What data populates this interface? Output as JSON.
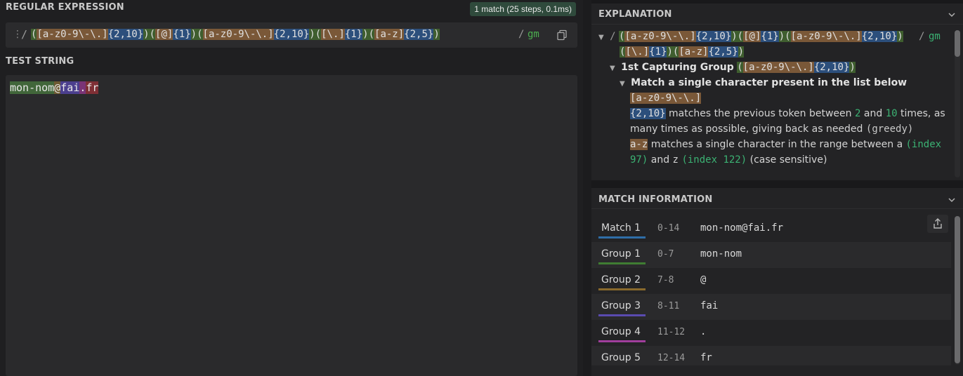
{
  "regex_section": {
    "title": "REGULAR EXPRESSION",
    "match_badge": "1 match (25 steps, 0.1ms)",
    "delimiter": "/",
    "tokens": {
      "t1": "(",
      "t2": "[a-z0-9\\-\\.]",
      "t3": "{2,10}",
      "t4": ")",
      "t5": "(",
      "t6": "[@]",
      "t7": "{1}",
      "t8": ")",
      "t9": "(",
      "t10": "[a-z0-9\\-\\.]",
      "t11": "{2,10}",
      "t12": ")",
      "t13": "(",
      "t14": "[\\.]",
      "t15": "{1}",
      "t16": ")",
      "t17": "(",
      "t18": "[a-z]",
      "t19": "{2,5}",
      "t20": ")"
    },
    "flags_delimiter": "/",
    "flags": "gm"
  },
  "test_section": {
    "title": "TEST STRING",
    "parts": [
      "mon-nom",
      "@",
      "fai",
      ".",
      "fr"
    ]
  },
  "explanation": {
    "title": "EXPLANATION",
    "line1_slash": "/",
    "line1_tokens": [
      "(",
      "[a-z0-9\\-\\.]",
      "{2,10}",
      ")",
      "(",
      "[@]",
      "{1}",
      ")",
      "(",
      "[a-z0-9\\-\\.]",
      "{2,10}",
      ")"
    ],
    "line1_flags_slash": "/",
    "line1_flags": "gm",
    "line2_tokens": [
      "(",
      "[\\.]",
      "{1}",
      ")",
      "(",
      "[a-z]",
      "{2,5}",
      ")"
    ],
    "group1_label": "1st Capturing Group",
    "group1_tokens": [
      "(",
      "[a-z0-9\\-\\.]",
      "{2,10}",
      ")"
    ],
    "match_single": "Match a single character present in the list below",
    "char_class": "[a-z0-9\\-\\.]",
    "quant_token": "{2,10}",
    "quant_text_a": "matches the previous token between",
    "quant_min": "2",
    "quant_and": "and",
    "quant_max": "10",
    "quant_text_b": "times, as",
    "quant_line2_a": "many times as possible, giving back as needed",
    "quant_greedy": "(greedy)",
    "range_token": "a-z",
    "range_text": "matches a single character in the range between",
    "range_a": "a",
    "range_index_a_open": "(index",
    "range_index_a_close": "97)",
    "range_and": "and",
    "range_z": "z",
    "range_index_z": "(index 122)",
    "range_case": "(case sensitive)"
  },
  "match_info": {
    "title": "MATCH INFORMATION",
    "rows": [
      {
        "label": "Match 1",
        "range": "0-14",
        "value": "mon-nom@fai.fr",
        "color": "#2f6ea8"
      },
      {
        "label": "Group 1",
        "range": "0-7",
        "value": "mon-nom",
        "color": "#3f7d32"
      },
      {
        "label": "Group 2",
        "range": "7-8",
        "value": "@",
        "color": "#8a6a2c"
      },
      {
        "label": "Group 3",
        "range": "8-11",
        "value": "fai",
        "color": "#5a4bb0"
      },
      {
        "label": "Group 4",
        "range": "11-12",
        "value": ".",
        "color": "#a03e9c"
      },
      {
        "label": "Group 5",
        "range": "12-14",
        "value": "fr",
        "color": "#b03a40"
      }
    ]
  }
}
